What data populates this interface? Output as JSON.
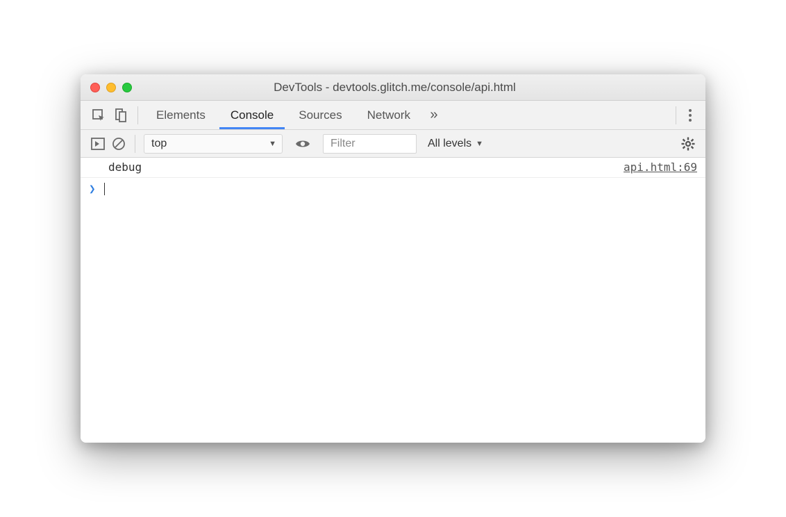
{
  "window": {
    "title": "DevTools - devtools.glitch.me/console/api.html"
  },
  "tabs": {
    "items": [
      "Elements",
      "Console",
      "Sources",
      "Network"
    ],
    "active": "Console"
  },
  "toolbar": {
    "context": "top",
    "filter_placeholder": "Filter",
    "levels_label": "All levels"
  },
  "console": {
    "logs": [
      {
        "message": "debug",
        "source": "api.html:69"
      }
    ],
    "prompt": "❯"
  },
  "icons": {
    "inspect": "inspect-icon",
    "device": "device-icon",
    "more_tabs": "»",
    "play_sidebar": "play-sidebar-icon",
    "clear": "clear-icon",
    "eye": "eye-icon",
    "gear": "gear-icon"
  }
}
